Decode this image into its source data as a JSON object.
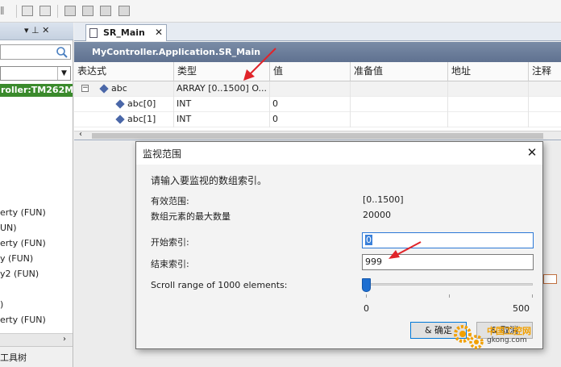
{
  "toolbar": {
    "left_fragment": "ǁ"
  },
  "left_panel": {
    "header_pin": "▾ ⊥ ✕",
    "controller_label": "roller:TM262M25",
    "items": [
      "erty (FUN)",
      "UN)",
      "erty (FUN)",
      "y (FUN)",
      "y2 (FUN)",
      ")",
      "erty (FUN)"
    ],
    "footer_label": "工具树"
  },
  "editor": {
    "tab_label": "SR_Main",
    "tab_close": "✕",
    "path": "MyController.Application.SR_Main",
    "columns": [
      "表达式",
      "类型",
      "值",
      "准备值",
      "地址",
      "注释"
    ],
    "rows": [
      {
        "expand": "−",
        "expression": "abc",
        "type": "ARRAY [0..1500] O...",
        "value": ""
      },
      {
        "expand": "",
        "expression": "abc[0]",
        "type": "INT",
        "value": "0"
      },
      {
        "expand": "",
        "expression": "abc[1]",
        "type": "INT",
        "value": "0"
      }
    ]
  },
  "dialog": {
    "title": "监视范围",
    "close_glyph": "✕",
    "prompt": "请输入要监视的数组索引。",
    "valid_range_label": "有效范围:",
    "valid_range_value": "[0..1500]",
    "max_elements_label": "数组元素的最大数量",
    "max_elements_value": "20000",
    "start_index_label": "开始索引:",
    "start_index_value": "0",
    "end_index_label": "结束索引:",
    "end_index_value": "999",
    "scroll_range_label": "Scroll range of 1000 elements:",
    "slider_min": "0",
    "slider_max": "500",
    "slider_value": 0,
    "ok_label": "& 确定",
    "cancel_label": "& 取消"
  },
  "watermark": {
    "text": "中国工控网",
    "url": "gkong.com"
  },
  "colors": {
    "controller_green": "#3a8a2c",
    "path_bar": "#6a7c98",
    "accent_blue": "#1e6fd1",
    "arrow_red": "#e0242a"
  }
}
